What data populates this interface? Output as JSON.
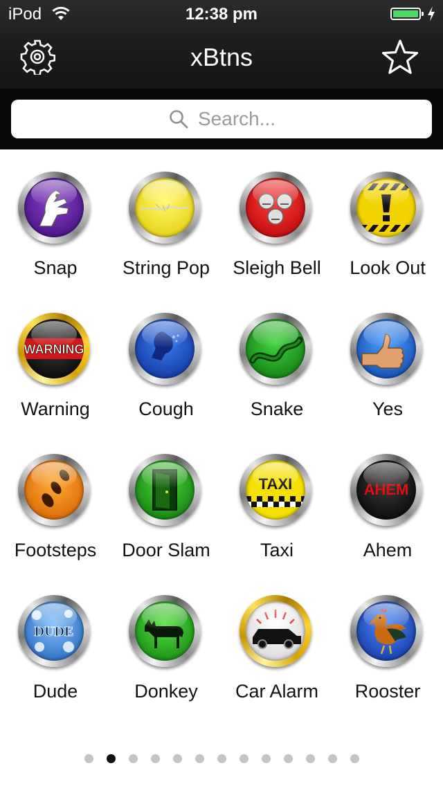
{
  "status": {
    "carrier": "iPod",
    "time": "12:38 pm",
    "battery_level": 1.0
  },
  "nav": {
    "title": "xBtns",
    "left_icon": "gear-icon",
    "right_icon": "star-icon"
  },
  "search": {
    "placeholder": "Search...",
    "value": ""
  },
  "buttons": [
    {
      "label": "Snap",
      "icon": "snap-icon",
      "color": "#5a1a9a"
    },
    {
      "label": "String Pop",
      "icon": "string-pop-icon",
      "color": "#f2e000"
    },
    {
      "label": "Sleigh Bell",
      "icon": "sleigh-bell-icon",
      "color": "#e01010"
    },
    {
      "label": "Look Out",
      "icon": "look-out-icon",
      "color": "#f0d000"
    },
    {
      "label": "Warning",
      "icon": "warning-icon",
      "color": "#cc1010"
    },
    {
      "label": "Cough",
      "icon": "cough-icon",
      "color": "#1f4fc0"
    },
    {
      "label": "Snake",
      "icon": "snake-icon",
      "color": "#1fa020"
    },
    {
      "label": "Yes",
      "icon": "thumbs-up-icon",
      "color": "#2070d8"
    },
    {
      "label": "Footsteps",
      "icon": "footsteps-icon",
      "color": "#f07a00"
    },
    {
      "label": "Door Slam",
      "icon": "door-icon",
      "color": "#22a01a"
    },
    {
      "label": "Taxi",
      "icon": "taxi-icon",
      "color": "#f5e000"
    },
    {
      "label": "Ahem",
      "icon": "ahem-icon",
      "color": "#1a1a1a"
    },
    {
      "label": "Dude",
      "icon": "dude-icon",
      "color": "#3a8ad8"
    },
    {
      "label": "Donkey",
      "icon": "donkey-icon",
      "color": "#2ab020"
    },
    {
      "label": "Car Alarm",
      "icon": "car-alarm-icon",
      "color": "#f0f0f0"
    },
    {
      "label": "Rooster",
      "icon": "rooster-icon",
      "color": "#2050b0"
    }
  ],
  "face_text": {
    "warning": "WARNING",
    "taxi": "TAXI",
    "ahem": "AHEM",
    "dude": "DUDE"
  },
  "pager": {
    "count": 13,
    "active": 1
  }
}
